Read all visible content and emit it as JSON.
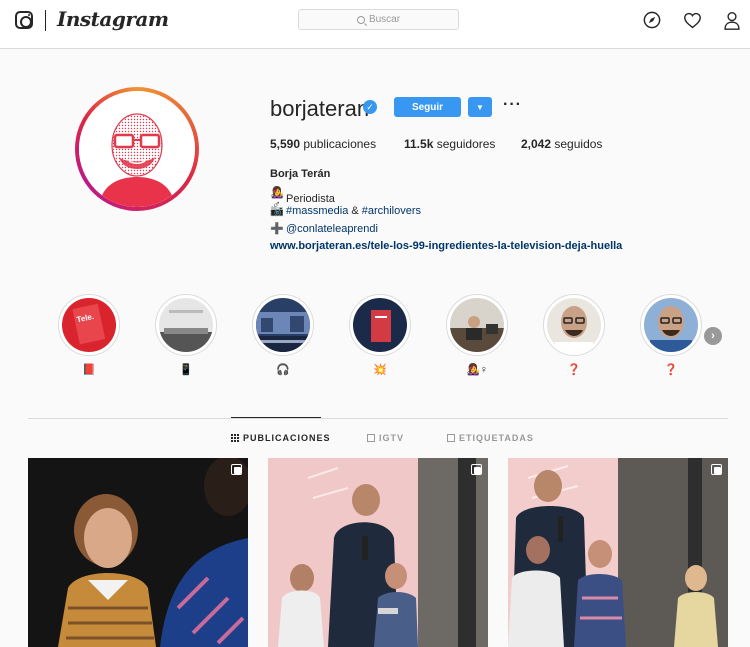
{
  "app": {
    "wordmark": "Instagram"
  },
  "search": {
    "placeholder": "Buscar"
  },
  "nav": {
    "icons": [
      "camera-icon",
      "compass-icon",
      "heart-icon",
      "user-icon"
    ]
  },
  "profile": {
    "username": "borjateran",
    "verified": true,
    "follow_label": "Seguir",
    "dropdown_glyph": "▼",
    "more_glyph": "···",
    "stats": {
      "posts": "5,590",
      "posts_label": "publicaciones",
      "followers": "11.5k",
      "followers_label": "seguidores",
      "following": "2,042",
      "following_label": "seguidos"
    },
    "bio": {
      "name": "Borja Terán",
      "line1_icon": "👩‍🎤♂",
      "line1_text": "Periodista",
      "line2_icon": "📷",
      "line2_tag1": "#massmedia",
      "line2_amp": "&",
      "line2_tag2": "#archilovers",
      "line3_icon": "➕",
      "line3_mention": "@conlateleaprendi",
      "link": "www.borjateran.es/tele-los-99-ingredientes-la-television-deja-huella"
    }
  },
  "highlights": [
    {
      "label": "📕"
    },
    {
      "label": "📱"
    },
    {
      "label": "🎧"
    },
    {
      "label": "💥"
    },
    {
      "label": "👩‍🎤♀"
    },
    {
      "label": "❓"
    },
    {
      "label": "❓"
    }
  ],
  "highlights_next_glyph": "›",
  "tabs": [
    {
      "label": "PUBLICACIONES",
      "active": true
    },
    {
      "label": "IGTV",
      "active": false
    },
    {
      "label": "ETIQUETADAS",
      "active": false
    }
  ],
  "colors": {
    "accent": "#3897f0",
    "link": "#003569",
    "border": "#dbdbdb",
    "background": "#fafafa"
  }
}
